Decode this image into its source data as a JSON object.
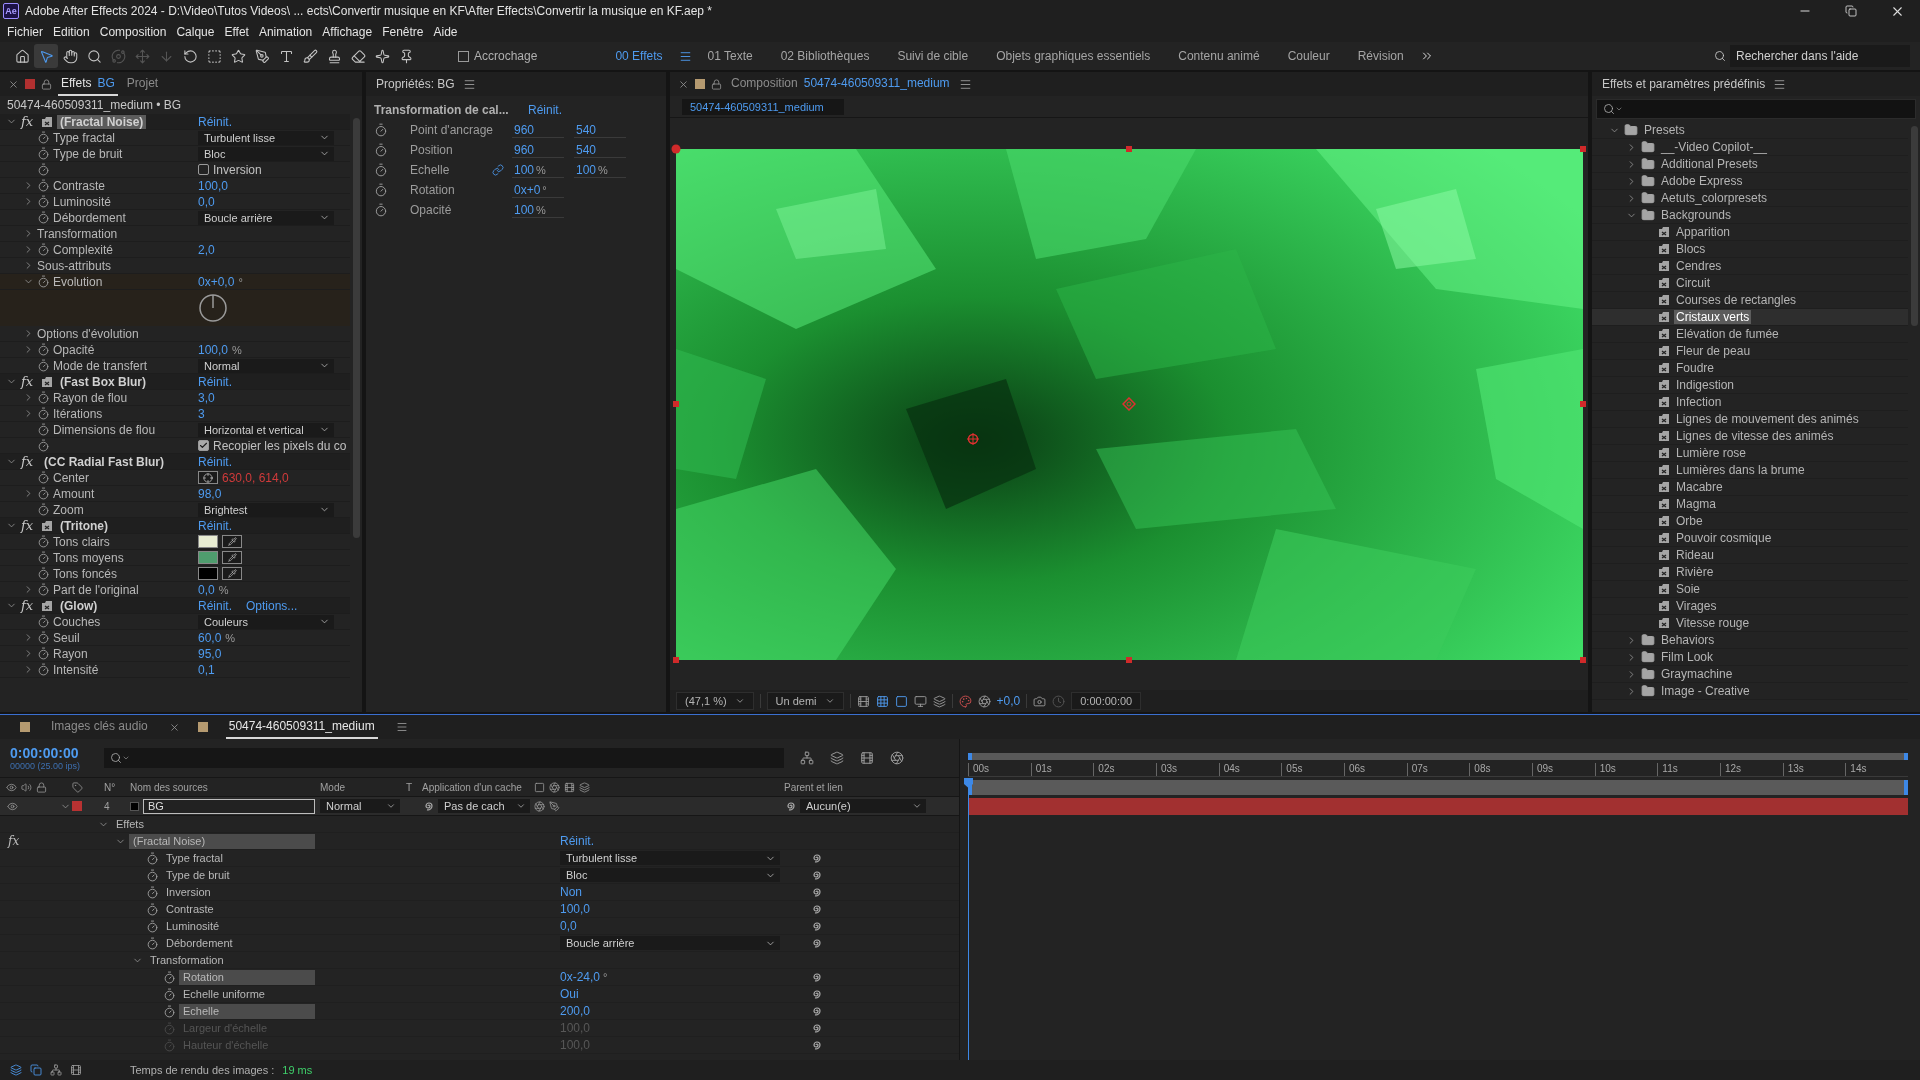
{
  "window": {
    "logo": "Ae",
    "title": "Adobe After Effects 2024 - D:\\Video\\Tutos Videos\\ ... ects\\Convertir musique en KF\\After Effects\\Convertir la musique en KF.aep *"
  },
  "menu": [
    "Fichier",
    "Edition",
    "Composition",
    "Calque",
    "Effet",
    "Animation",
    "Affichage",
    "Fenêtre",
    "Aide"
  ],
  "toolbar": {
    "tools": [
      {
        "kind": "home",
        "selected": false,
        "disabled": false
      },
      {
        "kind": "select",
        "selected": true,
        "disabled": false
      },
      {
        "kind": "hand",
        "selected": false,
        "disabled": false
      },
      {
        "kind": "zoom",
        "selected": false,
        "disabled": false
      },
      {
        "kind": "orbit",
        "selected": false,
        "disabled": true
      },
      {
        "kind": "move",
        "selected": false,
        "disabled": true
      },
      {
        "kind": "dolly",
        "selected": false,
        "disabled": true
      },
      {
        "kind": "rotate",
        "selected": false,
        "disabled": false
      },
      {
        "kind": "region",
        "selected": false,
        "disabled": false
      },
      {
        "kind": "shape",
        "selected": false,
        "disabled": false
      },
      {
        "kind": "pen",
        "selected": false,
        "disabled": false
      },
      {
        "kind": "type",
        "selected": false,
        "disabled": false
      },
      {
        "kind": "brush",
        "selected": false,
        "disabled": false
      },
      {
        "kind": "stamp",
        "selected": false,
        "disabled": false
      },
      {
        "kind": "eraser",
        "selected": false,
        "disabled": false
      },
      {
        "kind": "roto",
        "selected": false,
        "disabled": false
      },
      {
        "kind": "puppet",
        "selected": false,
        "disabled": false
      }
    ],
    "snap": {
      "label": "Accrochage",
      "checked": false
    },
    "workspaces": [
      {
        "label": "00 Effets",
        "selected": true
      },
      {
        "label": "01 Texte",
        "selected": false
      },
      {
        "label": "02 Bibliothèques",
        "selected": false
      },
      {
        "label": "Suivi de cible",
        "selected": false
      },
      {
        "label": "Objets graphiques essentiels",
        "selected": false
      },
      {
        "label": "Contenu animé",
        "selected": false
      },
      {
        "label": "Couleur",
        "selected": false
      },
      {
        "label": "Révision",
        "selected": false
      }
    ],
    "search": {
      "placeholder": "Rechercher dans l'aide"
    }
  },
  "effects_panel": {
    "tabs": [
      {
        "label": "Effets",
        "layer": "BG",
        "selected": true
      },
      {
        "label": "Projet",
        "selected": false
      }
    ],
    "layer_path": "50474-460509311_medium • BG",
    "effects": [
      {
        "fx": "fx",
        "name": "(Fractal Noise)",
        "icon": true,
        "highlighted": true,
        "reset": "Réinit.",
        "props": [
          {
            "kind": "dropdown",
            "label": "Type fractal",
            "value": "Turbulent lisse"
          },
          {
            "kind": "dropdown",
            "label": "Type de bruit",
            "value": "Bloc"
          },
          {
            "kind": "checkbox",
            "text": "Inversion",
            "checked": false
          },
          {
            "kind": "number",
            "label": "Contraste",
            "value": "100,0",
            "expanded": false
          },
          {
            "kind": "number",
            "label": "Luminosité",
            "value": "0,0",
            "expanded": false
          },
          {
            "kind": "dropdown",
            "label": "Débordement",
            "value": "Boucle arrière"
          },
          {
            "kind": "group",
            "label": "Transformation",
            "expanded": false
          },
          {
            "kind": "number",
            "label": "Complexité",
            "value": "2,0",
            "expanded": false
          },
          {
            "kind": "group",
            "label": "Sous-attributs",
            "expanded": false
          },
          {
            "kind": "angle",
            "label": "Evolution",
            "value": "0x+0,0",
            "unit": "°",
            "expanded": true
          },
          {
            "kind": "group",
            "label": "Options d'évolution",
            "expanded": false
          },
          {
            "kind": "number",
            "label": "Opacité",
            "value": "100,0",
            "unit": "%",
            "expanded": false
          },
          {
            "kind": "dropdown",
            "label": "Mode de transfert",
            "value": "Normal"
          }
        ]
      },
      {
        "fx": "fx",
        "name": "(Fast Box Blur)",
        "icon": true,
        "highlighted": false,
        "reset": "Réinit.",
        "props": [
          {
            "kind": "number",
            "label": "Rayon de flou",
            "value": "3,0",
            "expanded": false
          },
          {
            "kind": "number",
            "label": "Itérations",
            "value": "3",
            "expanded": false
          },
          {
            "kind": "dropdown",
            "label": "Dimensions de flou",
            "value": "Horizontal et vertical"
          },
          {
            "kind": "checkbox",
            "text": "Recopier les pixels du co",
            "checked": true
          }
        ]
      },
      {
        "fx": "fx",
        "name": "(CC Radial Fast Blur)",
        "icon": false,
        "highlighted": false,
        "reset": "Réinit.",
        "props": [
          {
            "kind": "point",
            "label": "Center",
            "value": "630,0, 614,0"
          },
          {
            "kind": "number",
            "label": "Amount",
            "value": "98,0",
            "expanded": false
          },
          {
            "kind": "dropdown",
            "label": "Zoom",
            "value": "Brightest"
          }
        ]
      },
      {
        "fx": "fx",
        "name": "(Tritone)",
        "icon": true,
        "highlighted": false,
        "reset": "Réinit.",
        "props": [
          {
            "kind": "color",
            "label": "Tons clairs",
            "color": "#e8ecd2"
          },
          {
            "kind": "color",
            "label": "Tons moyens",
            "color": "#4f9d6e"
          },
          {
            "kind": "color",
            "label": "Tons foncés",
            "color": "#000000"
          },
          {
            "kind": "number",
            "label": "Part de l'original",
            "value": "0,0",
            "unit": "%",
            "expanded": false
          }
        ]
      },
      {
        "fx": "fx",
        "name": "(Glow)",
        "icon": true,
        "highlighted": false,
        "reset": "Réinit.",
        "options": "Options...",
        "props": [
          {
            "kind": "dropdown",
            "label": "Couches",
            "value": "Couleurs"
          },
          {
            "kind": "number",
            "label": "Seuil",
            "value": "60,0",
            "unit": "%",
            "expanded": false
          },
          {
            "kind": "number",
            "label": "Rayon",
            "value": "95,0",
            "expanded": false
          },
          {
            "kind": "number",
            "label": "Intensité",
            "value": "0,1",
            "expanded": false
          }
        ]
      }
    ]
  },
  "properties_panel": {
    "title": "Propriétés: BG",
    "section": "Transformation de cal...",
    "reset": "Réinit.",
    "rows": [
      {
        "label": "Point d'ancrage",
        "linked": false,
        "values": [
          {
            "value": "960"
          },
          {
            "value": "540"
          }
        ]
      },
      {
        "label": "Position",
        "linked": false,
        "values": [
          {
            "value": "960"
          },
          {
            "value": "540"
          }
        ]
      },
      {
        "label": "Echelle",
        "linked": true,
        "values": [
          {
            "value": "100",
            "unit": "%"
          },
          {
            "value": "100",
            "unit": "%"
          }
        ]
      },
      {
        "label": "Rotation",
        "linked": false,
        "values": [
          {
            "value": "0x+0",
            "unit": "°"
          }
        ]
      },
      {
        "label": "Opacité",
        "linked": false,
        "values": [
          {
            "value": "100",
            "unit": "%"
          }
        ]
      }
    ]
  },
  "composition_panel": {
    "label": "Composition",
    "name": "50474-460509311_medium",
    "breadcrumb": "50474-460509311_medium",
    "viewer": {
      "zoom": "(47,1 %)",
      "resolution": "Un demi",
      "exposure": "+0,0",
      "timecode": "0:00:00:00"
    }
  },
  "presets_panel": {
    "title": "Effets et paramètres prédéfinis",
    "tree": [
      {
        "label": "Presets",
        "kind": "folder",
        "expanded": true,
        "selected": false,
        "children": [
          {
            "label": "__-Video Copilot-__",
            "kind": "folder",
            "expanded": false,
            "selected": false
          },
          {
            "label": "Additional Presets",
            "kind": "folder",
            "expanded": false,
            "selected": false
          },
          {
            "label": "Adobe Express",
            "kind": "folder",
            "expanded": false,
            "selected": false
          },
          {
            "label": "Aetuts_colorpresets",
            "kind": "folder",
            "expanded": false,
            "selected": false
          },
          {
            "label": "Backgrounds",
            "kind": "folder",
            "expanded": true,
            "selected": false,
            "children": [
              {
                "label": "Apparition",
                "kind": "preset",
                "selected": false
              },
              {
                "label": "Blocs",
                "kind": "preset",
                "selected": false
              },
              {
                "label": "Cendres",
                "kind": "preset",
                "selected": false
              },
              {
                "label": "Circuit",
                "kind": "preset",
                "selected": false
              },
              {
                "label": "Courses de rectangles",
                "kind": "preset",
                "selected": false
              },
              {
                "label": "Cristaux verts",
                "kind": "preset",
                "selected": true
              },
              {
                "label": "Elévation de fumée",
                "kind": "preset",
                "selected": false
              },
              {
                "label": "Fleur de peau",
                "kind": "preset",
                "selected": false
              },
              {
                "label": "Foudre",
                "kind": "preset",
                "selected": false
              },
              {
                "label": "Indigestion",
                "kind": "preset",
                "selected": false
              },
              {
                "label": "Infection",
                "kind": "preset",
                "selected": false
              },
              {
                "label": "Lignes de mouvement des animés",
                "kind": "preset",
                "selected": false
              },
              {
                "label": "Lignes de vitesse des animés",
                "kind": "preset",
                "selected": false
              },
              {
                "label": "Lumière rose",
                "kind": "preset",
                "selected": false
              },
              {
                "label": "Lumières dans la brume",
                "kind": "preset",
                "selected": false
              },
              {
                "label": "Macabre",
                "kind": "preset",
                "selected": false
              },
              {
                "label": "Magma",
                "kind": "preset",
                "selected": false
              },
              {
                "label": "Orbe",
                "kind": "preset",
                "selected": false
              },
              {
                "label": "Pouvoir cosmique",
                "kind": "preset",
                "selected": false
              },
              {
                "label": "Rideau",
                "kind": "preset",
                "selected": false
              },
              {
                "label": "Rivière",
                "kind": "preset",
                "selected": false
              },
              {
                "label": "Soie",
                "kind": "preset",
                "selected": false
              },
              {
                "label": "Virages",
                "kind": "preset",
                "selected": false
              },
              {
                "label": "Vitesse rouge",
                "kind": "preset",
                "selected": false
              }
            ]
          },
          {
            "label": "Behaviors",
            "kind": "folder",
            "expanded": false,
            "selected": false
          },
          {
            "label": "Film Look",
            "kind": "folder",
            "expanded": false,
            "selected": false
          },
          {
            "label": "Graymachine",
            "kind": "folder",
            "expanded": false,
            "selected": false
          },
          {
            "label": "Image - Creative",
            "kind": "folder",
            "expanded": false,
            "selected": false
          }
        ]
      }
    ]
  },
  "timeline": {
    "tabs": [
      {
        "label": "Images clés audio",
        "selected": false
      },
      {
        "label": "50474-460509311_medium",
        "selected": true
      }
    ],
    "timecode": "0:00:00:00",
    "fps": "00000 (25.00 ips)",
    "columns": {
      "number": "N°",
      "source": "Nom des sources",
      "mode": "Mode",
      "t": "T",
      "matte": "Application d'un cache",
      "parent": "Parent et lien"
    },
    "layer": {
      "visible": true,
      "expanded": true,
      "color": "#b83232",
      "number": "4",
      "name": "BG",
      "mode": "Normal",
      "matte": "Pas de cach",
      "parent": "Aucun(e)"
    },
    "tree": [
      {
        "label": "Effets",
        "kind": "group",
        "expanded": true,
        "selected": false,
        "disabled": false,
        "children": [
          {
            "label": "(Fractal Noise)",
            "kind": "effect",
            "fx": "fx",
            "value": "Réinit.",
            "expanded": true,
            "selected": true,
            "disabled": false,
            "children": [
              {
                "label": "Type fractal",
                "kind": "dropdown",
                "value": "Turbulent lisse",
                "selected": false,
                "disabled": false
              },
              {
                "label": "Type de bruit",
                "kind": "dropdown",
                "value": "Bloc",
                "selected": false,
                "disabled": false
              },
              {
                "label": "Inversion",
                "kind": "value",
                "value": "Non",
                "selected": false,
                "disabled": false
              },
              {
                "label": "Contraste",
                "kind": "value",
                "value": "100,0",
                "selected": false,
                "disabled": false
              },
              {
                "label": "Luminosité",
                "kind": "value",
                "value": "0,0",
                "selected": false,
                "disabled": false
              },
              {
                "label": "Débordement",
                "kind": "dropdown",
                "value": "Boucle arrière",
                "selected": false,
                "disabled": false
              },
              {
                "label": "Transformation",
                "kind": "group",
                "expanded": true,
                "selected": false,
                "disabled": false,
                "children": [
                  {
                    "label": "Rotation",
                    "kind": "value",
                    "value": "0x-24,0",
                    "unit": "°",
                    "selected": true,
                    "disabled": false
                  },
                  {
                    "label": "Echelle uniforme",
                    "kind": "value",
                    "value": "Oui",
                    "selected": false,
                    "disabled": false
                  },
                  {
                    "label": "Echelle",
                    "kind": "value",
                    "value": "200,0",
                    "selected": true,
                    "disabled": false
                  },
                  {
                    "label": "Largeur d'échelle",
                    "kind": "value",
                    "value": "100,0",
                    "selected": false,
                    "disabled": true
                  },
                  {
                    "label": "Hauteur d'échelle",
                    "kind": "value",
                    "value": "100,0",
                    "selected": false,
                    "disabled": true
                  }
                ]
              }
            ]
          }
        ]
      }
    ],
    "ruler": [
      "00s",
      "01s",
      "02s",
      "03s",
      "04s",
      "05s",
      "06s",
      "07s",
      "08s",
      "09s",
      "10s",
      "11s",
      "12s",
      "13s",
      "14s"
    ],
    "render_label": "Temps de rendu des images :",
    "render_time": "19 ms"
  }
}
